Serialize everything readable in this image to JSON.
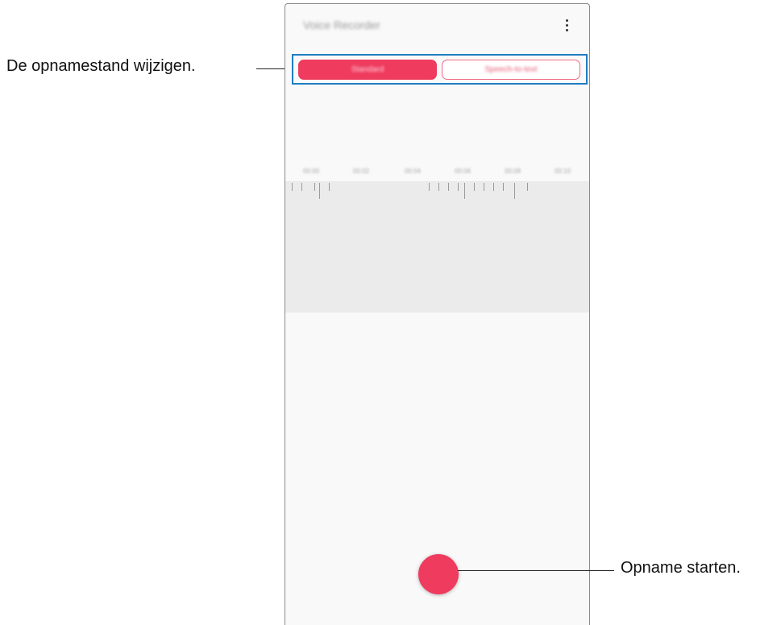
{
  "app": {
    "title": "Voice Recorder",
    "menu_icon": "more-vertical-icon"
  },
  "modes": {
    "standard_label": "Standard",
    "interview_label": "Speech-to-text"
  },
  "timeline": {
    "ticks": [
      "00:00",
      "00:02",
      "00:04",
      "00:06",
      "00:08",
      "00:10"
    ]
  },
  "record": {
    "icon": "record-icon"
  },
  "callouts": {
    "mode_change": "De opnamestand wijzigen.",
    "start_recording": "Opname starten."
  },
  "colors": {
    "accent": "#ef3b5e",
    "highlight_box": "#1e7cc4"
  }
}
